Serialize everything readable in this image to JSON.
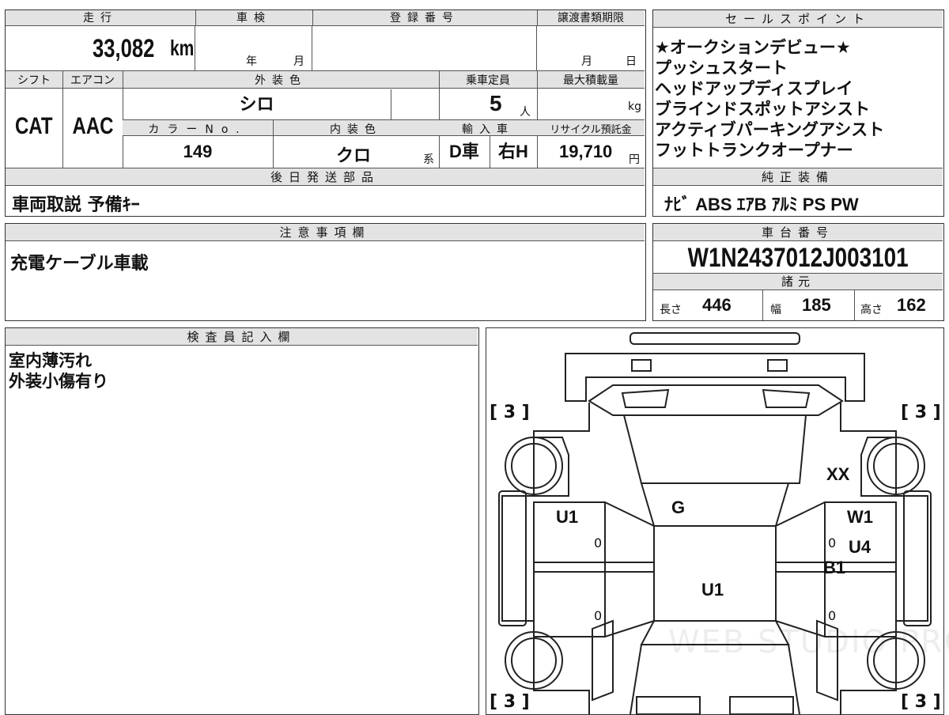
{
  "top": {
    "mileage_label": "走行",
    "mileage_value": "33,082",
    "mileage_unit": "km",
    "inspection_label": "車検",
    "inspection_year": "年",
    "inspection_month": "月",
    "registration_label": "登録番号",
    "transfer_label": "譲渡書類期限",
    "transfer_month": "月",
    "transfer_day": "日",
    "shift_label": "シフト",
    "shift_value": "CAT",
    "ac_label": "エアコン",
    "ac_value": "AAC",
    "exterior_color_label": "外装色",
    "exterior_color_value": "シロ",
    "capacity_label": "乗車定員",
    "capacity_value": "5",
    "capacity_unit": "人",
    "max_load_label": "最大積載量",
    "max_load_unit": "kg",
    "color_no_label": "カラーNo.",
    "color_no_value": "149",
    "interior_color_label": "内装色",
    "interior_color_value": "クロ",
    "interior_color_suffix": "系",
    "import_label": "輸入車",
    "import_value": "D車",
    "steering_value": "右H",
    "recycle_label": "リサイクル預託金",
    "recycle_value": "19,710",
    "recycle_unit": "円"
  },
  "later_shipping": {
    "label": "後日発送部品",
    "value": "車両取説 予備ｷｰ"
  },
  "sales_points": {
    "label": "セールスポイント",
    "items": [
      "★オークションデビュー★",
      "プッシュスタート",
      "ヘッドアップディスプレイ",
      "ブラインドスポットアシスト",
      "アクティブパーキングアシスト",
      "フットトランクオープナー"
    ]
  },
  "standard_equipment": {
    "label": "純正装備",
    "value": "ﾅﾋﾞ ABS ｴｱB ｱﾙﾐ PS PW"
  },
  "notes": {
    "label": "注意事項欄",
    "value": "充電ケーブル車載"
  },
  "chassis": {
    "label": "車台番号",
    "value": "W1N2437012J003101"
  },
  "specs": {
    "label": "諸元",
    "length_label": "長さ",
    "length_value": "446",
    "width_label": "幅",
    "width_value": "185",
    "height_label": "高さ",
    "height_value": "162"
  },
  "inspector": {
    "label": "検査員記入欄",
    "lines": [
      "室内薄汚れ",
      "外装小傷有り"
    ]
  },
  "diagram": {
    "tire_marks": [
      "[ 3 ]",
      "[ 3 ]",
      "[ 3 ]",
      "[ 3 ]"
    ],
    "marks": {
      "xx": "XX",
      "g": "G",
      "u1_left": "U1",
      "w1": "W1",
      "u4": "U4",
      "b1": "B1",
      "u1_center": "U1",
      "zero": "0"
    },
    "watermark": "WEB STUDIO PRO"
  }
}
